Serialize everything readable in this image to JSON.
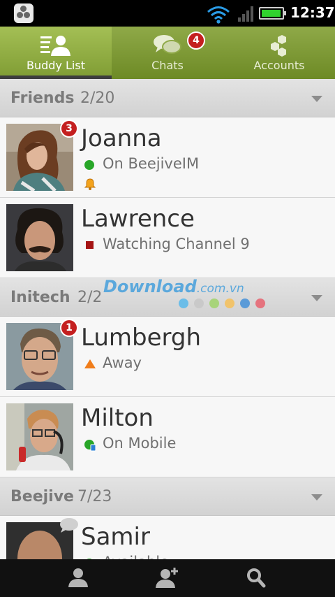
{
  "status_bar": {
    "time": "12:37",
    "battery_level": 0.95,
    "signal_bars": 0,
    "icons": [
      "beejive-logo-icon",
      "wifi-icon",
      "signal-icon",
      "battery-icon"
    ]
  },
  "tabs": [
    {
      "label": "Buddy List",
      "icon": "buddy-list-icon",
      "active": true
    },
    {
      "label": "Chats",
      "icon": "chat-bubbles-icon",
      "badge": "4"
    },
    {
      "label": "Accounts",
      "icon": "hexagons-icon"
    }
  ],
  "groups": [
    {
      "name": "Friends",
      "count": "2/20",
      "buddies": [
        {
          "name": "Joanna",
          "status": "On BeejiveIM",
          "indicator": "green-dot",
          "unread": "3",
          "alert": "bell-icon"
        },
        {
          "name": "Lawrence",
          "status": "Watching Channel 9",
          "indicator": "red-square"
        }
      ]
    },
    {
      "name": "Initech",
      "count": "2/2",
      "buddies": [
        {
          "name": "Lumbergh",
          "status": "Away",
          "indicator": "orange-triangle",
          "unread": "1"
        },
        {
          "name": "Milton",
          "status": "On Mobile",
          "indicator": "green-mobile"
        }
      ]
    },
    {
      "name": "Beejive",
      "count": "7/23",
      "buddies": [
        {
          "name": "Samir",
          "status": "Available",
          "indicator": "green-dot",
          "chat": "chat-bubble-icon"
        }
      ]
    }
  ],
  "watermark": {
    "brand": "Download",
    "suffix": ".com.vn",
    "dot_colors": [
      "#6bbde8",
      "#c9c9c9",
      "#a8d47a",
      "#f1c36b",
      "#5b9bd8",
      "#e5737e"
    ]
  },
  "bottom_bar": [
    "contacts-icon",
    "add-contact-icon",
    "search-icon"
  ],
  "colors": {
    "accent_green": "#7f9c33",
    "badge_red": "#c41f1f",
    "online_green": "#28a628",
    "away_orange": "#f07d1a",
    "busy_red": "#a51414"
  }
}
